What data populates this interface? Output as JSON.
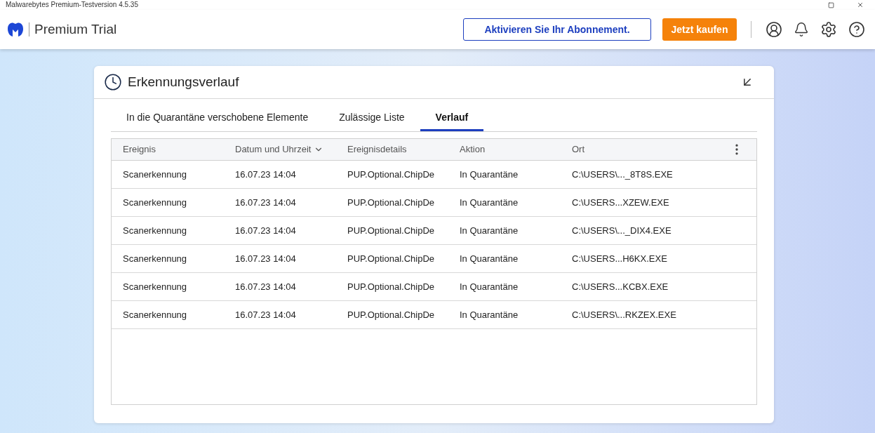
{
  "window": {
    "title": "Malwarebytes Premium-Testversion 4.5.35"
  },
  "header": {
    "product": "Premium Trial",
    "activate_button": "Aktivieren Sie Ihr Abonnement.",
    "buy_button": "Jetzt kaufen"
  },
  "panel": {
    "title": "Erkennungsverlauf",
    "tabs": [
      {
        "label": "In die Quarantäne verschobene Elemente",
        "selected": false
      },
      {
        "label": "Zulässige Liste",
        "selected": false
      },
      {
        "label": "Verlauf",
        "selected": true
      }
    ],
    "table": {
      "columns": [
        {
          "label": "Ereignis",
          "sorted": false
        },
        {
          "label": "Datum und Uhrzeit",
          "sorted": true
        },
        {
          "label": "Ereignisdetails",
          "sorted": false
        },
        {
          "label": "Aktion",
          "sorted": false
        },
        {
          "label": "Ort",
          "sorted": false
        }
      ],
      "rows": [
        [
          "Scanerkennung",
          "16.07.23 14:04",
          "PUP.Optional.ChipDe",
          "In Quarantäne",
          "C:\\USERS\\..._8T8S.EXE"
        ],
        [
          "Scanerkennung",
          "16.07.23 14:04",
          "PUP.Optional.ChipDe",
          "In Quarantäne",
          "C:\\USERS...XZEW.EXE"
        ],
        [
          "Scanerkennung",
          "16.07.23 14:04",
          "PUP.Optional.ChipDe",
          "In Quarantäne",
          "C:\\USERS\\..._DIX4.EXE"
        ],
        [
          "Scanerkennung",
          "16.07.23 14:04",
          "PUP.Optional.ChipDe",
          "In Quarantäne",
          "C:\\USERS...H6KX.EXE"
        ],
        [
          "Scanerkennung",
          "16.07.23 14:04",
          "PUP.Optional.ChipDe",
          "In Quarantäne",
          "C:\\USERS...KCBX.EXE"
        ],
        [
          "Scanerkennung",
          "16.07.23 14:04",
          "PUP.Optional.ChipDe",
          "In Quarantäne",
          "C:\\USERS\\...RKZEX.EXE"
        ]
      ]
    }
  }
}
